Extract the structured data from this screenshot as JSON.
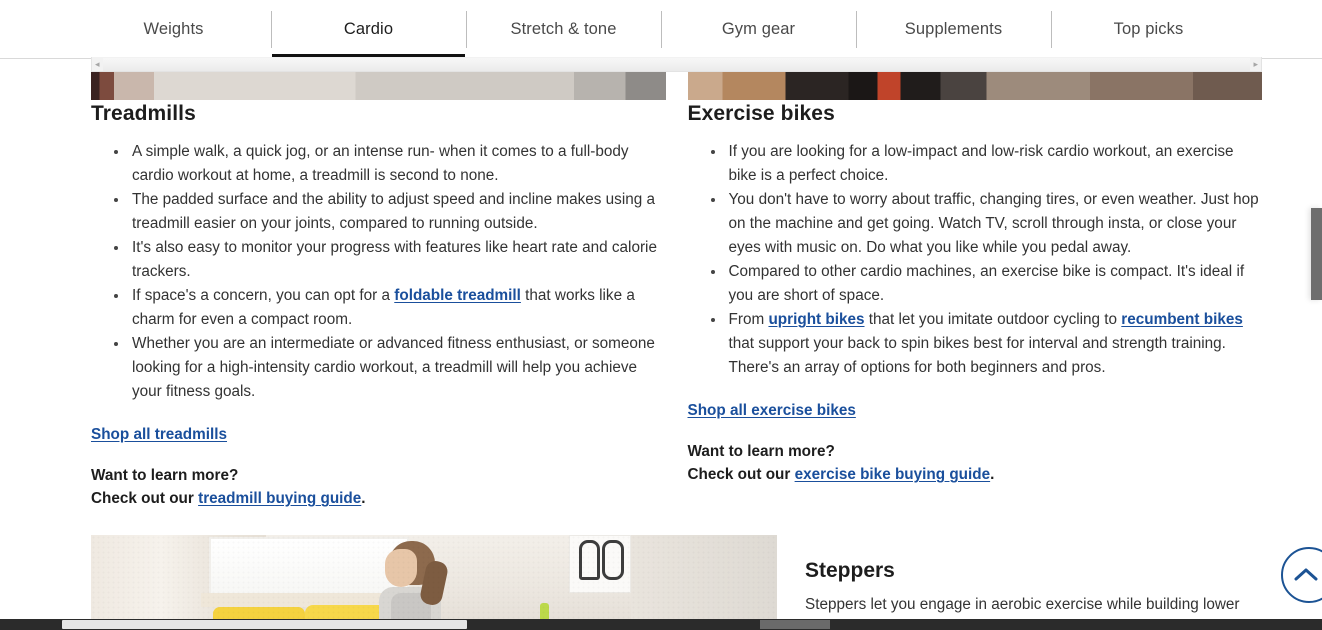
{
  "tabs": [
    {
      "label": "Weights",
      "active": false
    },
    {
      "label": "Cardio",
      "active": true
    },
    {
      "label": "Stretch & tone",
      "active": false
    },
    {
      "label": "Gym gear",
      "active": false
    },
    {
      "label": "Supplements",
      "active": false
    },
    {
      "label": "Top picks",
      "active": false
    }
  ],
  "scrollbar": {
    "left_arrow": "◂",
    "right_arrow": "▸"
  },
  "columns": {
    "treadmills": {
      "title": "Treadmills",
      "bullets": [
        {
          "text_before": "A simple walk, a quick jog, or an intense run- when it comes to a full-body cardio workout at home, a treadmill is second to none."
        },
        {
          "text_before": "The padded surface and the ability to adjust speed and incline makes using a treadmill easier on your joints, compared to running outside."
        },
        {
          "text_before": "It's also easy to monitor your progress with features like heart rate and calorie trackers."
        },
        {
          "text_before": "If space's a concern, you can opt for a ",
          "link": "foldable treadmill",
          "text_after": " that works like a charm for even a compact room."
        },
        {
          "text_before": "Whether you are an intermediate or advanced fitness enthusiast, or someone looking for a high-intensity cardio workout, a treadmill will help you achieve your fitness goals."
        }
      ],
      "shop_link": "Shop all treadmills",
      "learn_more_question": "Want to learn more?",
      "check_out_prefix": "Check out our ",
      "guide_link": "treadmill buying guide",
      "check_out_suffix": "."
    },
    "exercise_bikes": {
      "title": "Exercise bikes",
      "bullets": [
        {
          "text_before": "If you are looking for a low-impact and low-risk cardio workout, an exercise bike is a perfect choice."
        },
        {
          "text_before": "You don't have to worry about traffic, changing tires, or even weather. Just hop on the machine and get going. Watch TV, scroll through insta, or close your eyes with music on. Do what you like while you pedal away."
        },
        {
          "text_before": "Compared to other cardio machines, an exercise bike is compact. It's ideal if you are short of space."
        },
        {
          "text_before": "From ",
          "link": "upright bikes",
          "text_mid": " that let you imitate outdoor cycling to ",
          "link2": "recumbent bikes",
          "text_after": " that support your back to spin bikes best for interval and strength training. There's an array of options for both beginners and pros."
        }
      ],
      "shop_link": "Shop all exercise bikes",
      "learn_more_question": "Want to learn more?",
      "check_out_prefix": "Check out our ",
      "guide_link": "exercise bike buying guide",
      "check_out_suffix": "."
    }
  },
  "bottom": {
    "title": "Steppers",
    "paragraph": "Steppers let you engage in aerobic exercise while building lower"
  },
  "back_to_top": {
    "icon": "chevron-up-icon",
    "color": "#1c5394"
  },
  "colors": {
    "link": "#1a4f9c",
    "text": "#333333",
    "heading": "#1d1d1d",
    "active_tab_underline": "#111111"
  }
}
